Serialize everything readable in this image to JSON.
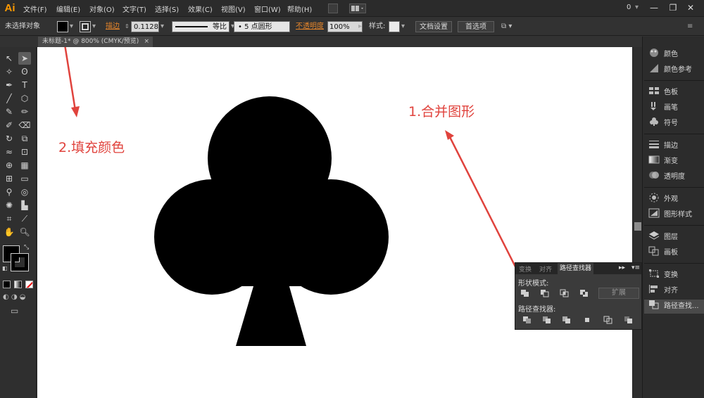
{
  "app": {
    "logo": "Ai"
  },
  "menu": {
    "items": [
      "文件(F)",
      "编辑(E)",
      "对象(O)",
      "文字(T)",
      "选择(S)",
      "效果(C)",
      "视图(V)",
      "窗口(W)",
      "帮助(H)"
    ],
    "right_value": "0"
  },
  "window_controls": {
    "minimize": "—",
    "restore": "❐",
    "close": "✕"
  },
  "control_bar": {
    "selection_status": "未选择对象",
    "stroke_label": "描边",
    "stroke_weight": "0.1128",
    "stroke_profile": "等比",
    "brush": "5 点圆形",
    "opacity_label": "不透明度",
    "opacity_value": "100%",
    "style_label": "样式:",
    "doc_setup_button": "文档设置",
    "preferences_button": "首选项"
  },
  "document_tab": {
    "title": "未标题-1* @ 800% (CMYK/预览)",
    "close": "×"
  },
  "dock": {
    "items": [
      "颜色",
      "颜色参考",
      "色板",
      "画笔",
      "符号",
      "描边",
      "渐变",
      "透明度",
      "外观",
      "图形样式",
      "图层",
      "画板",
      "变换",
      "对齐",
      "路径查找..."
    ],
    "selected": "路径查找..."
  },
  "pathfinder_panel": {
    "tabs": [
      "变换",
      "对齐",
      "路径查找器"
    ],
    "active_tab": "路径查找器",
    "shape_modes_label": "形状模式:",
    "expand_button": "扩展",
    "pathfinders_label": "路径查找器:"
  },
  "annotations": {
    "step1": "1.合并图形",
    "step2": "2.填充颜色"
  },
  "colors": {
    "annotation": "#e0433d",
    "accent_orange": "#e8862a",
    "shape_fill": "#000000"
  }
}
